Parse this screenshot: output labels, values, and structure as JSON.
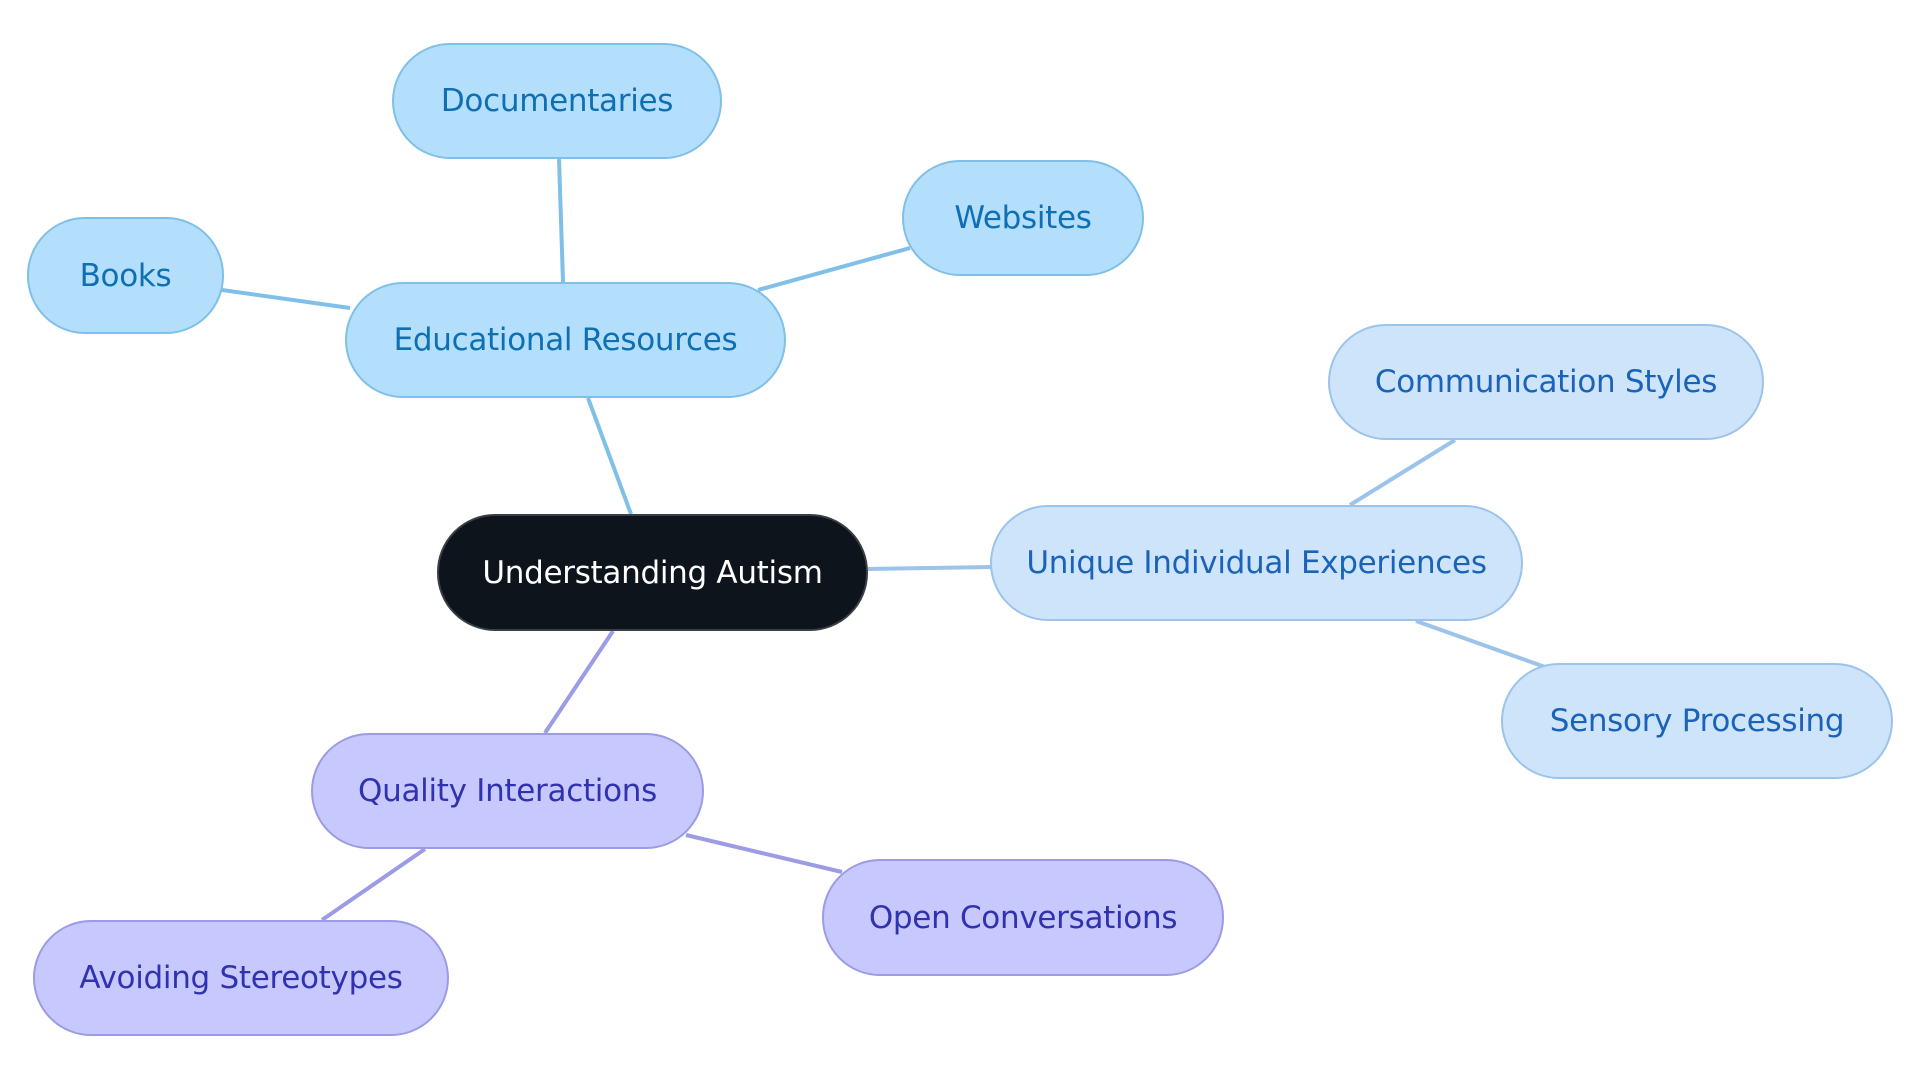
{
  "diagram": {
    "type": "mind-map",
    "root": {
      "id": "root",
      "label": "Understanding Autism"
    },
    "branches": [
      {
        "id": "edu",
        "label": "Educational Resources",
        "color": {
          "fill": "#b3dffc",
          "stroke": "#80bfe8",
          "text": "#0f6fb3",
          "edge": "#80bfe8"
        },
        "children": [
          {
            "id": "documentaries",
            "label": "Documentaries"
          },
          {
            "id": "websites",
            "label": "Websites"
          },
          {
            "id": "books",
            "label": "Books"
          }
        ]
      },
      {
        "id": "uni",
        "label": "Unique Individual Experiences",
        "color": {
          "fill": "#cde4fb",
          "stroke": "#9cc3ea",
          "text": "#1b63b8",
          "edge": "#9cc3ea"
        },
        "children": [
          {
            "id": "communication",
            "label": "Communication Styles"
          },
          {
            "id": "sensory",
            "label": "Sensory Processing"
          }
        ]
      },
      {
        "id": "qual",
        "label": "Quality Interactions",
        "color": {
          "fill": "#c7c8fd",
          "stroke": "#9b9be6",
          "text": "#3132b0",
          "edge": "#9b9be6"
        },
        "children": [
          {
            "id": "open",
            "label": "Open Conversations"
          },
          {
            "id": "avoiding",
            "label": "Avoiding Stereotypes"
          }
        ]
      }
    ],
    "root_color": {
      "fill": "#0d141c",
      "text": "#ffffff"
    }
  }
}
